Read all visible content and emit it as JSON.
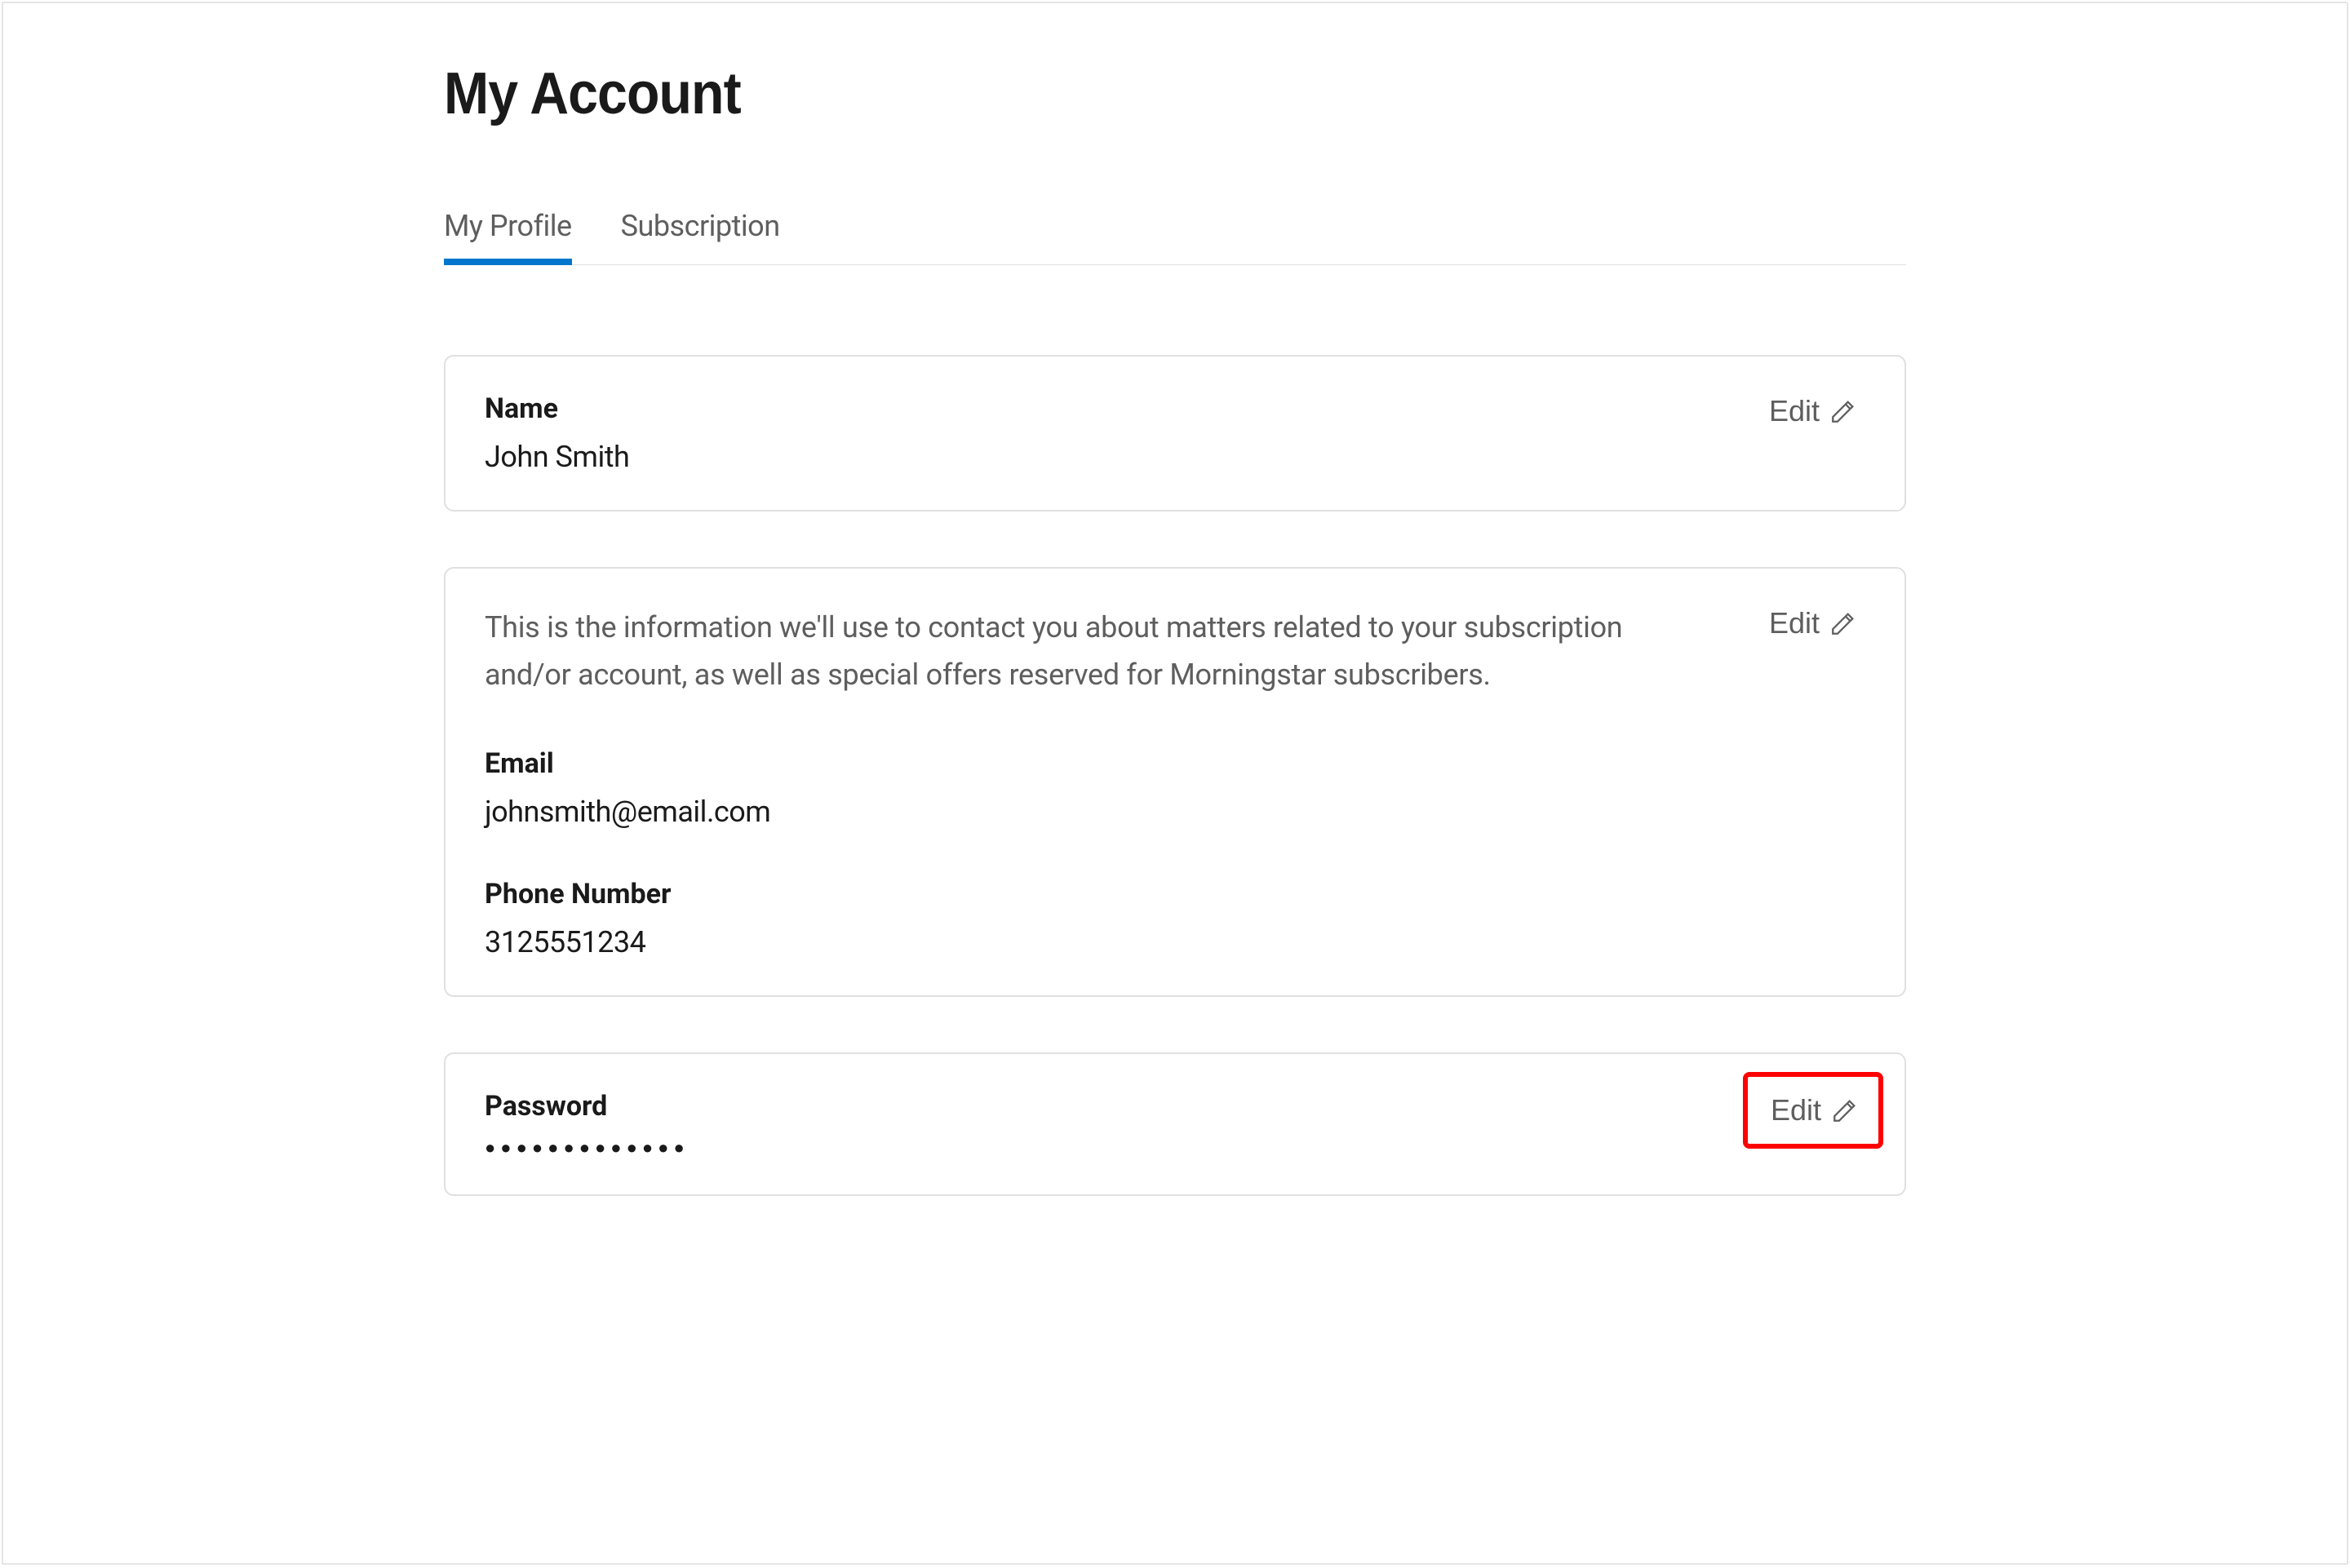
{
  "page": {
    "title": "My Account"
  },
  "tabs": {
    "profile": "My Profile",
    "subscription": "Subscription"
  },
  "name_card": {
    "label": "Name",
    "value": "John Smith",
    "edit_label": "Edit"
  },
  "contact_card": {
    "description": "This is the information we'll use to contact you about matters related to your subscription and/or account, as well as special offers reserved for Morningstar subscribers.",
    "email_label": "Email",
    "email_value": "johnsmith@email.com",
    "phone_label": "Phone Number",
    "phone_value": "3125551234",
    "edit_label": "Edit"
  },
  "password_card": {
    "label": "Password",
    "masked": "●●●●●●●●●●●●●",
    "edit_label": "Edit"
  }
}
